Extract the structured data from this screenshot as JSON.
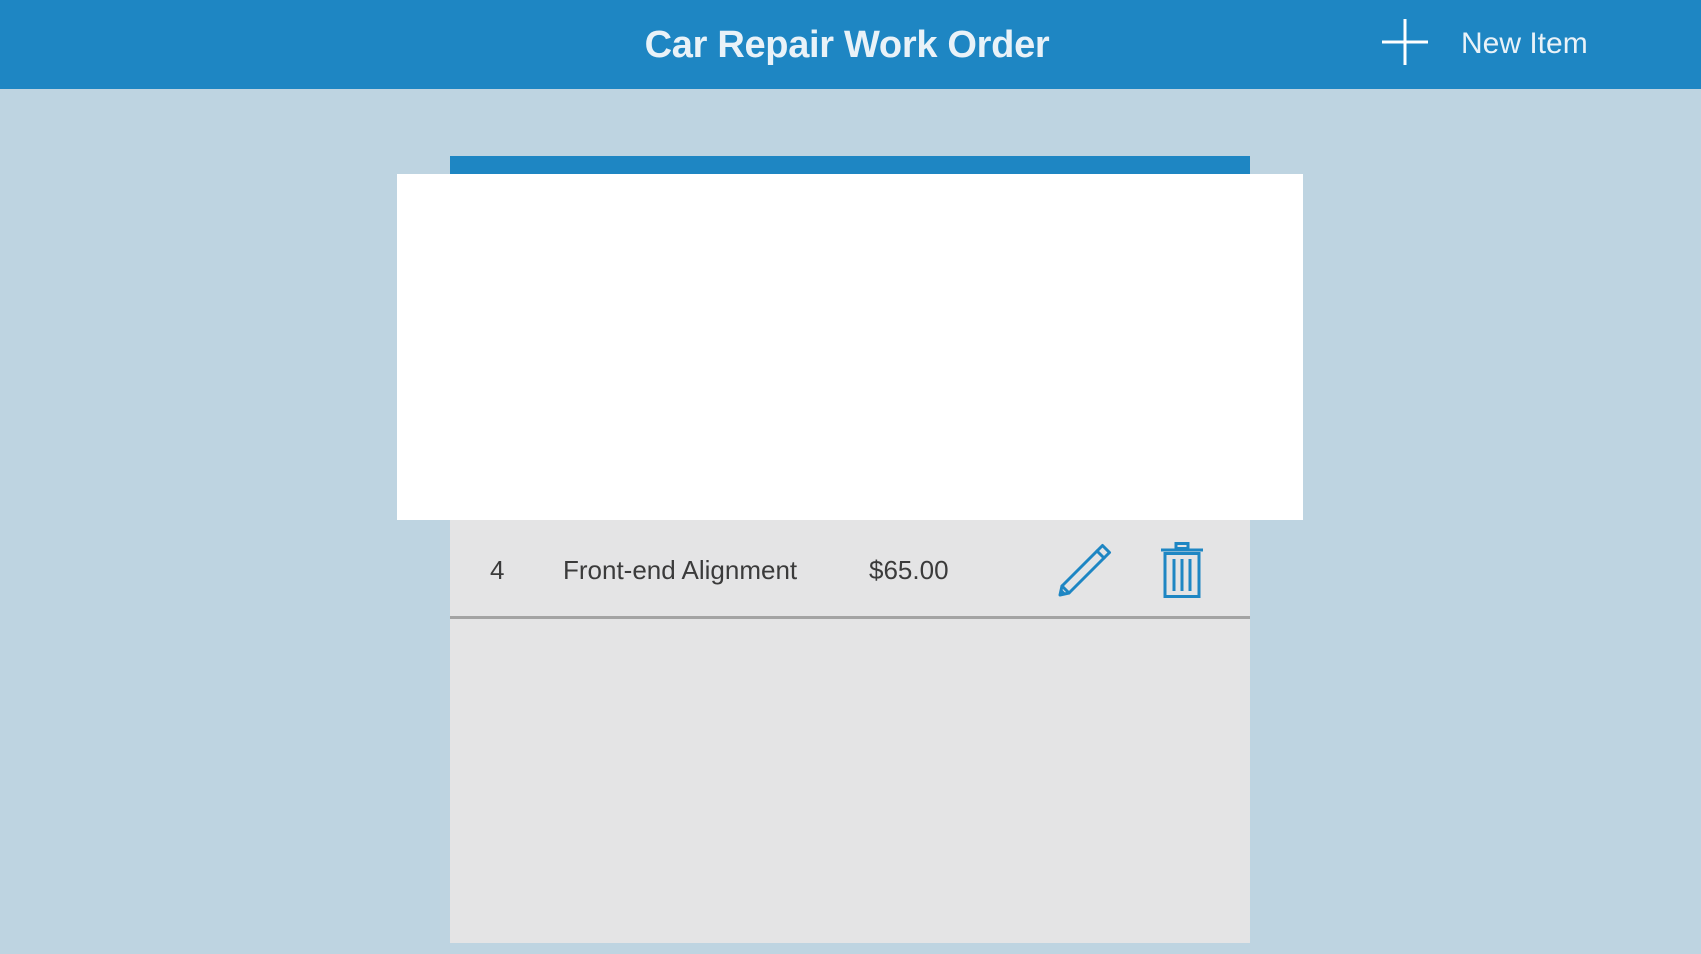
{
  "header": {
    "title": "Car Repair Work Order",
    "new_item_label": "New Item",
    "new_item_icon": "plus-icon"
  },
  "work_items": [
    {
      "number": "4",
      "description": "Front-end Alignment",
      "price": "$65.00",
      "edit_icon": "pencil-icon",
      "delete_icon": "trash-icon"
    }
  ],
  "colors": {
    "brand": "#1e86c3",
    "background": "#bed4e1",
    "panel": "#e4e4e5",
    "row_divider": "#a3a3a3"
  }
}
